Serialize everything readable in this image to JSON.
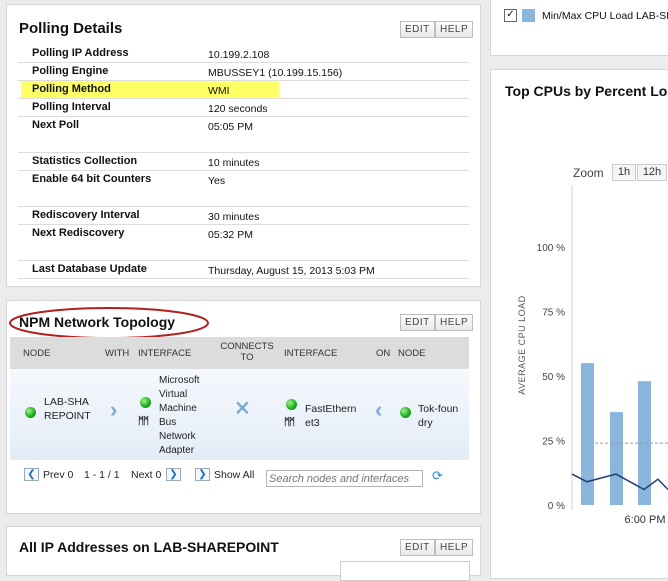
{
  "polling": {
    "title": "Polling Details",
    "edit": "EDIT",
    "help": "HELP",
    "rows": [
      {
        "label": "Polling IP Address",
        "value": "10.199.2.108"
      },
      {
        "label": "Polling Engine",
        "value": "MBUSSEY1 (10.199.15.156)"
      },
      {
        "label": "Polling Method",
        "value": "WMI"
      },
      {
        "label": "Polling Interval",
        "value": "120 seconds"
      },
      {
        "label": "Next Poll",
        "value": "05:05 PM"
      },
      {
        "label": "Statistics Collection",
        "value": "10 minutes"
      },
      {
        "label": "Enable 64 bit Counters",
        "value": "Yes"
      },
      {
        "label": "Rediscovery Interval",
        "value": "30 minutes"
      },
      {
        "label": "Next Rediscovery",
        "value": "05:32 PM"
      },
      {
        "label": "Last Database Update",
        "value": "Thursday, August 15, 2013 5:03 PM"
      }
    ]
  },
  "topology": {
    "title": "NPM Network Topology",
    "edit": "EDIT",
    "help": "HELP",
    "headers": {
      "node": "NODE",
      "with": "WITH",
      "interface": "INTERFACE",
      "connects_to": "CONNECTS TO",
      "interface2": "INTERFACE",
      "on": "ON",
      "node2": "NODE"
    },
    "row": {
      "node": "LAB-SHAREPOINT",
      "interface": "Microsoft Virtual Machine Bus Network Adapter",
      "interface2": "FastEthernet3",
      "node2": "Tok-foundry"
    },
    "pager": {
      "prev": "Prev 0",
      "range": "1 - 1 / 1",
      "next": "Next 0",
      "show_all": "Show All"
    },
    "search_placeholder": "Search nodes and interfaces"
  },
  "ip_addresses": {
    "title": "All IP Addresses on LAB-SHAREPOINT",
    "edit": "EDIT",
    "help": "HELP"
  },
  "legend": {
    "label": "Min/Max CPU Load LAB-SH",
    "checked": true
  },
  "chart_panel": {
    "title": "Top CPUs by Percent Lo",
    "zoom_label": "Zoom",
    "zoom_buttons": [
      "1h",
      "12h"
    ]
  },
  "chart_data": {
    "type": "bar",
    "ylabel": "AVERAGE CPU LOAD",
    "ylim": [
      0,
      100
    ],
    "ytick_labels": [
      "0 %",
      "25 %",
      "50 %",
      "75 %",
      "100 %"
    ],
    "xtick_labels": [
      "6:00 PM"
    ],
    "bars": [
      55,
      36,
      48
    ],
    "line": [
      12,
      9,
      12,
      6,
      10,
      6
    ],
    "reference_line": 24,
    "colors": {
      "bar": "#8ab6de",
      "line": "#1f3e6e"
    }
  }
}
